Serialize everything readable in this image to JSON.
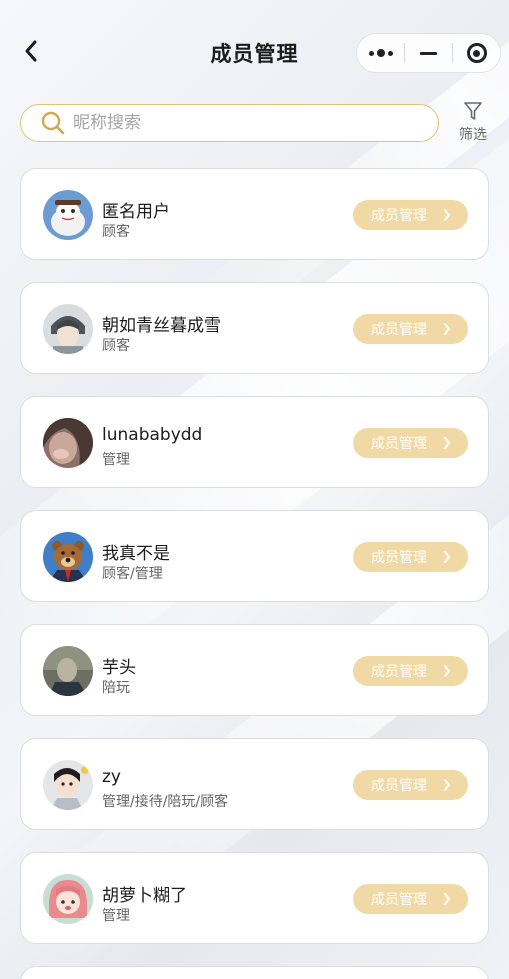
{
  "header": {
    "title": "成员管理"
  },
  "search": {
    "placeholder": "昵称搜索",
    "value": ""
  },
  "filter": {
    "label": "筛选"
  },
  "members": [
    {
      "name": "匿名用户",
      "role": "顾客",
      "button": "成员管理"
    },
    {
      "name": "朝如青丝暮成雪",
      "role": "顾客",
      "button": "成员管理"
    },
    {
      "name": "lunababydd",
      "role": "管理",
      "button": "成员管理"
    },
    {
      "name": "我真不是",
      "role": "顾客/管理",
      "button": "成员管理"
    },
    {
      "name": "芋头",
      "role": "陪玩",
      "button": "成员管理"
    },
    {
      "name": "zy",
      "role": "管理/接待/陪玩/顾客",
      "button": "成员管理"
    },
    {
      "name": "胡萝卜糊了",
      "role": "管理",
      "button": "成员管理"
    }
  ],
  "colors": {
    "accent_border": "#e2c17d",
    "button_bg": "#f0d9a5",
    "button_text": "#ffffff"
  }
}
